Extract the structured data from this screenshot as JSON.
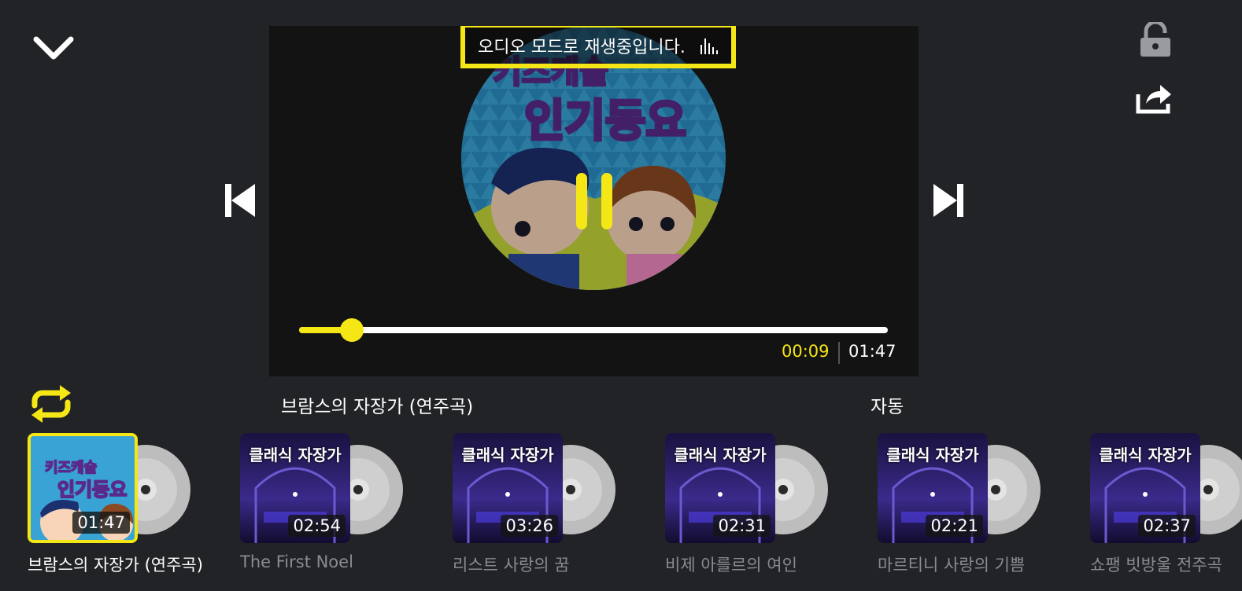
{
  "header": {
    "collapse_icon": "chevron-down-icon",
    "lock_icon": "unlock-icon",
    "share_icon": "share-icon"
  },
  "player": {
    "audio_mode_text": "오디오 모드로 재생중입니다.",
    "progress": 0.09,
    "current_time": "00:09",
    "total_time": "01:47",
    "accent": "#f5e615"
  },
  "now_playing": {
    "title": "브람스의 자장가 (연주곡)",
    "auto_label": "자동"
  },
  "playlist": [
    {
      "title": "브람스의 자장가 (연주곡)",
      "duration": "01:47",
      "thumb_text": "",
      "active": true
    },
    {
      "title": "The First Noel",
      "duration": "02:54",
      "thumb_text": "클래식 자장가",
      "active": false
    },
    {
      "title": "리스트 사랑의 꿈",
      "duration": "03:26",
      "thumb_text": "클래식 자장가",
      "active": false
    },
    {
      "title": "비제 아를르의 여인",
      "duration": "02:31",
      "thumb_text": "클래식 자장가",
      "active": false
    },
    {
      "title": "마르티니 사랑의 기쁨",
      "duration": "02:21",
      "thumb_text": "클래식 자장가",
      "active": false
    },
    {
      "title": "쇼팽 빗방울 전주곡",
      "duration": "02:37",
      "thumb_text": "클래식 자장가",
      "active": false
    }
  ]
}
